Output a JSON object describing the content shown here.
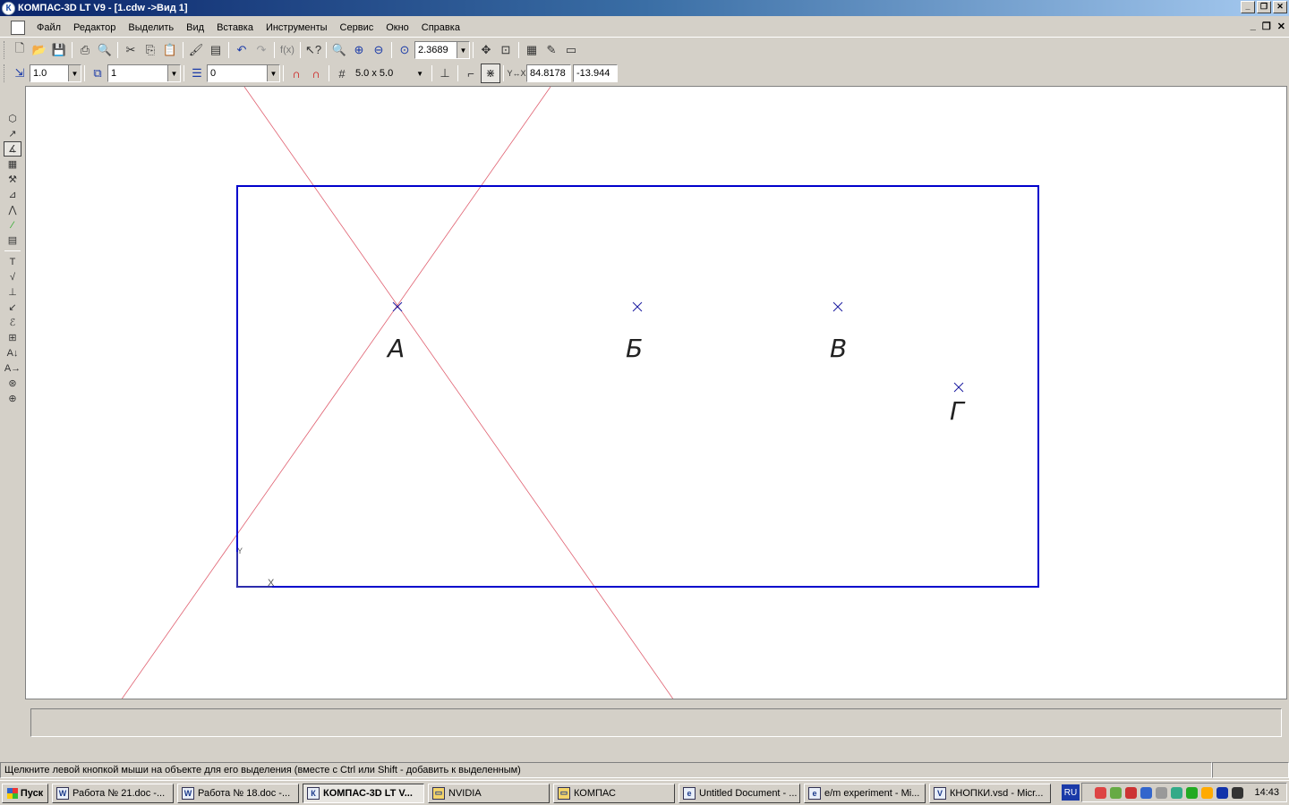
{
  "window": {
    "title": "КОМПАС-3D LT V9 - [1.cdw ->Вид 1]",
    "logo": "К"
  },
  "menu": [
    "Файл",
    "Редактор",
    "Выделить",
    "Вид",
    "Вставка",
    "Инструменты",
    "Сервис",
    "Окно",
    "Справка"
  ],
  "toolbar1": {
    "zoom_value": "2.3689"
  },
  "toolbar2": {
    "scale_value": "1.0",
    "layer_value": "1",
    "style_value": "0",
    "grid_value": "5.0 x 5.0",
    "coord_x": "84.8178",
    "coord_y": "-13.944"
  },
  "drawing": {
    "points": [
      {
        "label": "А"
      },
      {
        "label": "Б"
      },
      {
        "label": "В"
      },
      {
        "label": "Г"
      }
    ],
    "frame_color": "#0000cc",
    "aux_line_color": "#e06070",
    "axis_y": "Y",
    "axis_x": "X"
  },
  "status": {
    "hint": "Щелкните левой кнопкой мыши на объекте для его выделения (вместе с Ctrl или Shift - добавить к выделенным)"
  },
  "taskbar": {
    "start": "Пуск",
    "tasks": [
      {
        "label": "Работа № 21.doc -...",
        "icon": "W"
      },
      {
        "label": "Работа № 18.doc -...",
        "icon": "W"
      },
      {
        "label": "КОМПАС-3D LT V...",
        "icon": "К"
      },
      {
        "label": "NVIDIA",
        "icon": "▭"
      },
      {
        "label": "КОМПАС",
        "icon": "▭"
      },
      {
        "label": "Untitled Document - ...",
        "icon": "e"
      },
      {
        "label": "e/m experiment - Mi...",
        "icon": "e"
      },
      {
        "label": "КНОПКИ.vsd - Micr...",
        "icon": "V"
      }
    ],
    "lang": "RU",
    "clock": "14:43"
  }
}
